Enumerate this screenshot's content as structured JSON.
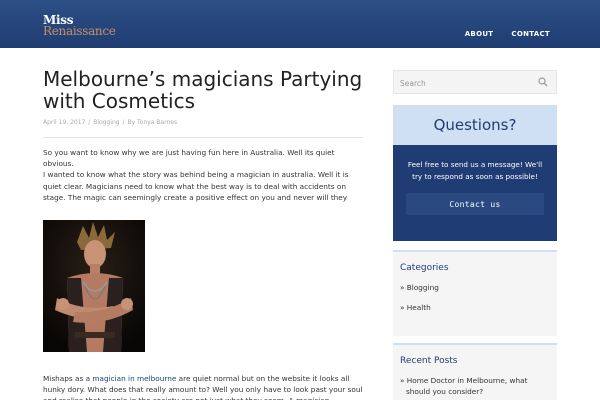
{
  "site": {
    "logo_line1": "Miss",
    "logo_line2": "Renaissance"
  },
  "nav": {
    "items": [
      {
        "label": "ABOUT"
      },
      {
        "label": "CONTACT"
      }
    ]
  },
  "post": {
    "title": "Melbourne’s magicians Partying with Cosmetics",
    "date": "April 19, 2017",
    "meta_sep": "/",
    "category": "Blogging",
    "meta_by": "By",
    "author": "Tonya Barnes",
    "paragraph1_line1": "So you want to know why we are just having fun here in Australia. Well its quiet obvious.",
    "paragraph1_line2": "I wanted to know what the story was behind being a magician in australia. Well it is quiet clear. Magicians need to know what the best way is to deal with accidents on stage. The magic can seemingly create a positive effect on you and never will they",
    "paragraph2_pre": "Mishaps as a ",
    "paragraph2_link": "magician in melbourne",
    "paragraph2_post": " are quiet normal but on the website it looks all hunky dory. What does that really amount to? Well you only have to look past your soul and realise that people in the society are not just what they seem. A magician"
  },
  "sidebar": {
    "search_placeholder": "Search",
    "questions": {
      "title": "Questions?",
      "text": "Feel free to send us a message! We'll try to respond as soon as possible!",
      "button": "Contact us"
    },
    "categories": {
      "title": "Categories",
      "items": [
        {
          "label": "» Blogging"
        },
        {
          "label": "» Health"
        }
      ]
    },
    "recent": {
      "title": "Recent Posts",
      "items": [
        {
          "label": "» Home Doctor in Melbourne, what should you consider?"
        }
      ]
    }
  },
  "colors": {
    "header": "#1f3d72",
    "accent": "#cfe0f2",
    "logo_accent": "#c98f6a"
  }
}
